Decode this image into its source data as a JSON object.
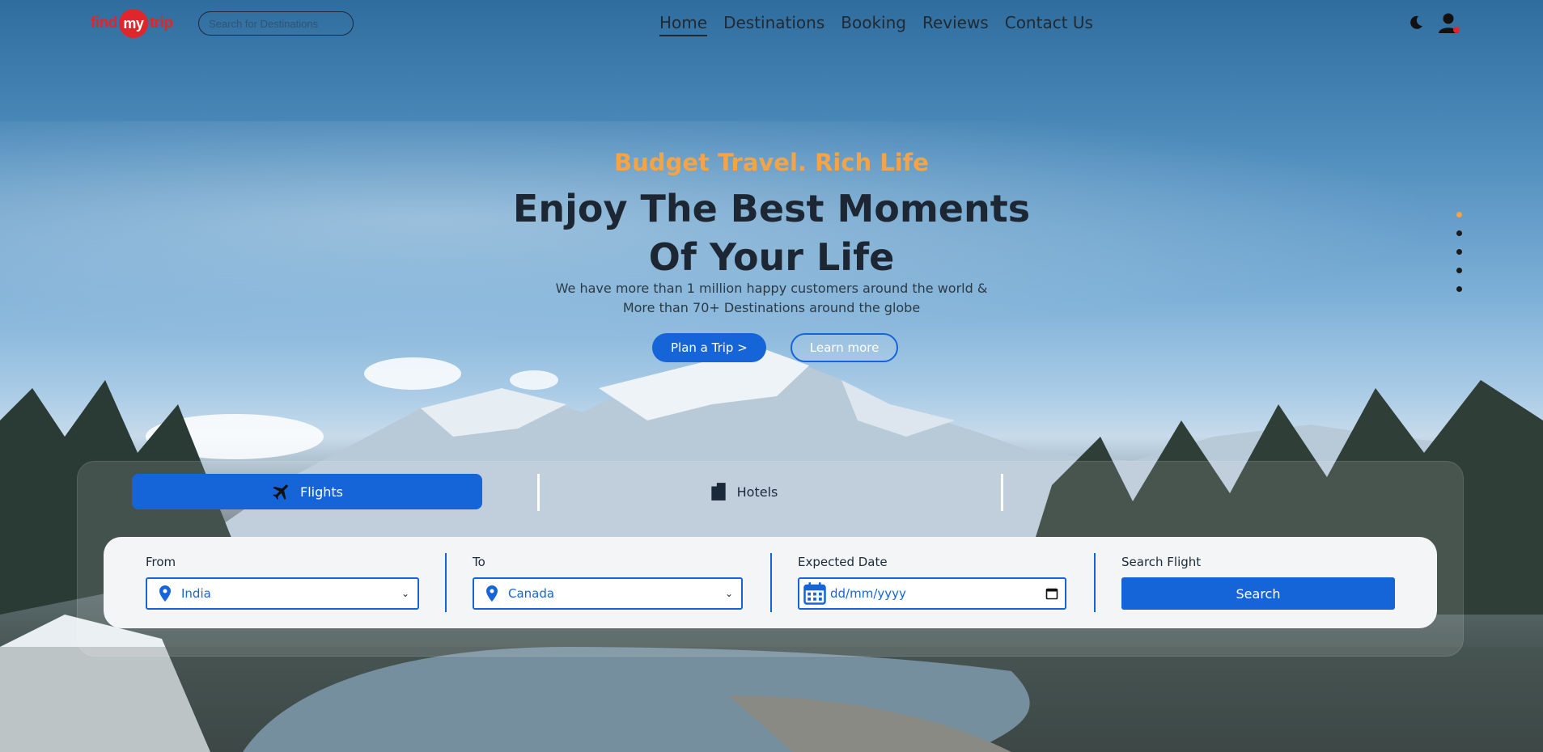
{
  "header": {
    "logo": {
      "find": "find",
      "my": "my",
      "trip": "trip"
    },
    "search_placeholder": "Search for Destinations",
    "nav": [
      "Home",
      "Destinations",
      "Booking",
      "Reviews",
      "Contact Us"
    ],
    "active_nav": "Home"
  },
  "hero": {
    "tagline": "Budget Travel. Rich Life",
    "headline_line1": "Enjoy The Best Moments",
    "headline_line2": "Of Your Life",
    "sub_line1": "We have more than 1 million happy customers around the world &",
    "sub_line2": "More than 70+ Destinations around the globe",
    "plan_button": "Plan a Trip >",
    "learn_button": "Learn more"
  },
  "slider": {
    "count": 5,
    "active_index": 0
  },
  "booking": {
    "tabs": {
      "flights": "Flights",
      "hotels": "Hotels",
      "third": ""
    },
    "from_label": "From",
    "from_value": "India",
    "to_label": "To",
    "to_value": "Canada",
    "date_label": "Expected Date",
    "date_placeholder": "dd/mm/yyyy",
    "search_label": "Search Flight",
    "search_button": "Search"
  },
  "colors": {
    "accent": "#1565d8",
    "tagline": "#f2a447",
    "logo": "#e0262c"
  }
}
